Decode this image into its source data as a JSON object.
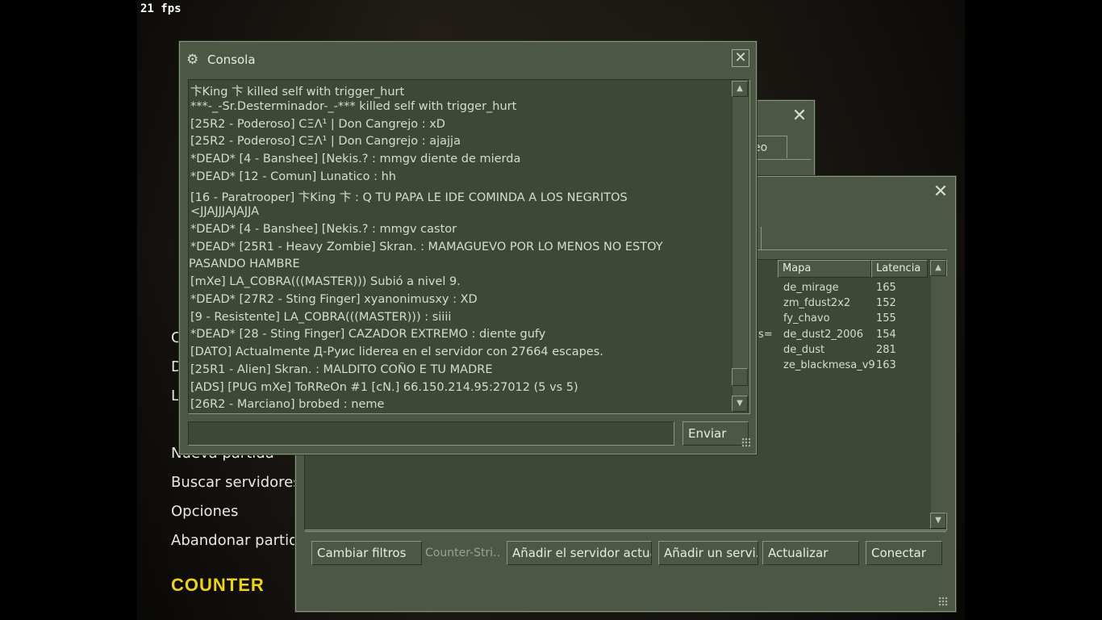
{
  "fps": "21 fps",
  "menu": {
    "partial_items": [
      "C",
      "D",
      "L"
    ],
    "items": [
      "Nueva partida",
      "Buscar servidores",
      "Opciones",
      "Abandonar partida"
    ],
    "logo": "COUNTER"
  },
  "back_window": {
    "tab_fragment": "eo"
  },
  "server_browser": {
    "columns": [
      "Mapa",
      "Latencia"
    ],
    "row_fragment": "s=",
    "rows": [
      {
        "map": "de_mirage",
        "latency": "165"
      },
      {
        "map": "zm_fdust2x2",
        "latency": "152"
      },
      {
        "map": "fy_chavo",
        "latency": "155"
      },
      {
        "map": "de_dust2_2006",
        "latency": "154"
      },
      {
        "map": "de_dust",
        "latency": "281"
      },
      {
        "map": "ze_blackmesa_v9",
        "latency": "163"
      }
    ],
    "buttons": {
      "change_filters": "Cambiar filtros",
      "game_label": "Counter-Stri..",
      "add_current": "Añadir el servidor actua",
      "add_server": "Añadir un servi...",
      "refresh": "Actualizar",
      "connect": "Conectar"
    }
  },
  "console": {
    "title": "Consola",
    "lines": [
      "卞King 卞 killed self with trigger_hurt",
      "***-_-Sr.Desterminador-_-*** killed self with trigger_hurt",
      "[25R2 - Poderoso] CΞΛ¹ | Don Cangrejo : xD",
      "[25R2 - Poderoso] CΞΛ¹ | Don Cangrejo : ajajja",
      "*DEAD* [4 - Banshee] [Nekis.? : mmgv diente de mierda",
      "*DEAD* [12 - Comun] Lunatico : hh",
      "[16 - Paratrooper] 卞King 卞 : Q TU PAPA LE IDE COMINDA A LOS NEGRITOS",
      "<JJAJJJAJAJJA",
      "*DEAD* [4 - Banshee] [Nekis.? : mmgv castor",
      "*DEAD* [25R1 - Heavy Zombie] Skran. : MAMAGUEVO POR  LO MENOS NO ESTOY",
      "PASANDO HAMBRE",
      "[mXe] LA_COBRA(((MASTER))) Subió a nivel 9.",
      "*DEAD* [27R2 - Sting Finger] xyanonimusxy : XD",
      "[9 - Resistente] LA_COBRA(((MASTER))) : siiii",
      "*DEAD* [28 - Sting Finger] CAZADOR EXTREMO : diente gufy",
      "[DATO] Actualmente Д-Руис liderea en el servidor con 27664 escapes.",
      "[25R1 - Alien] Skran. : MALDITO COÑO E TU MADRE",
      "[ADS] [PUG mXe] ToRReOn #1 [cN.]   66.150.214.95:27012   (5 vs 5)",
      "[26R2 - Marciano] brobed : neme"
    ],
    "input_value": "",
    "send_label": "Enviar"
  }
}
